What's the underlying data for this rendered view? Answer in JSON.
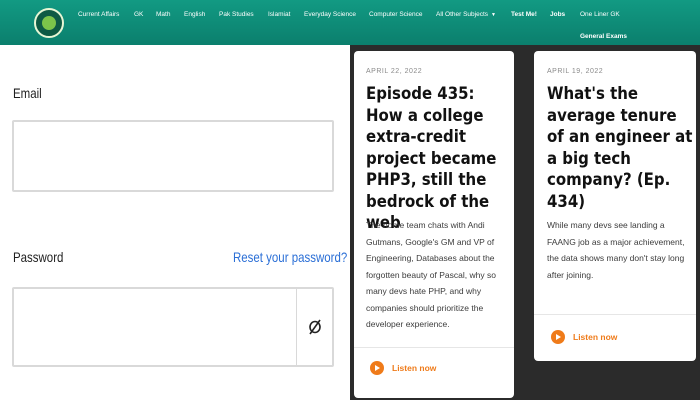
{
  "colors": {
    "nav_bg": "#0e8c77",
    "panel_bg": "#2b2b2b",
    "accent_orange": "#ef7b1a",
    "link_blue": "#2b6fd6"
  },
  "nav": {
    "logo_icon": "site-logo",
    "items": [
      "Current Affairs",
      "GK",
      "Math",
      "English",
      "Pak Studies",
      "Islamiat",
      "Everyday Science",
      "Computer Science",
      "All Other Subjects",
      "Test Me!",
      "Jobs",
      "One Liner GK",
      "General Exams"
    ]
  },
  "form": {
    "email_label": "Email",
    "password_label": "Password",
    "reset_link": "Reset your password?",
    "email_value": "",
    "password_value": "",
    "toggle_icon": "eye-slash-icon"
  },
  "articles": [
    {
      "date": "APRIL 22, 2022",
      "title": "Episode 435: How a college extra-credit project became PHP3, still the bedrock of the web",
      "body": "The home team chats with Andi Gutmans, Google's GM and VP of Engineering, Databases about the forgotten beauty of Pascal, why so many devs hate PHP, and why companies should prioritize the developer experience.",
      "listen_label": "Listen now"
    },
    {
      "date": "APRIL 19, 2022",
      "title": "What's the average tenure of an engineer at a big tech company? (Ep. 434)",
      "body": "While many devs see landing a FAANG job as a major achievement, the data shows many don't stay long after joining.",
      "listen_label": "Listen now"
    }
  ]
}
